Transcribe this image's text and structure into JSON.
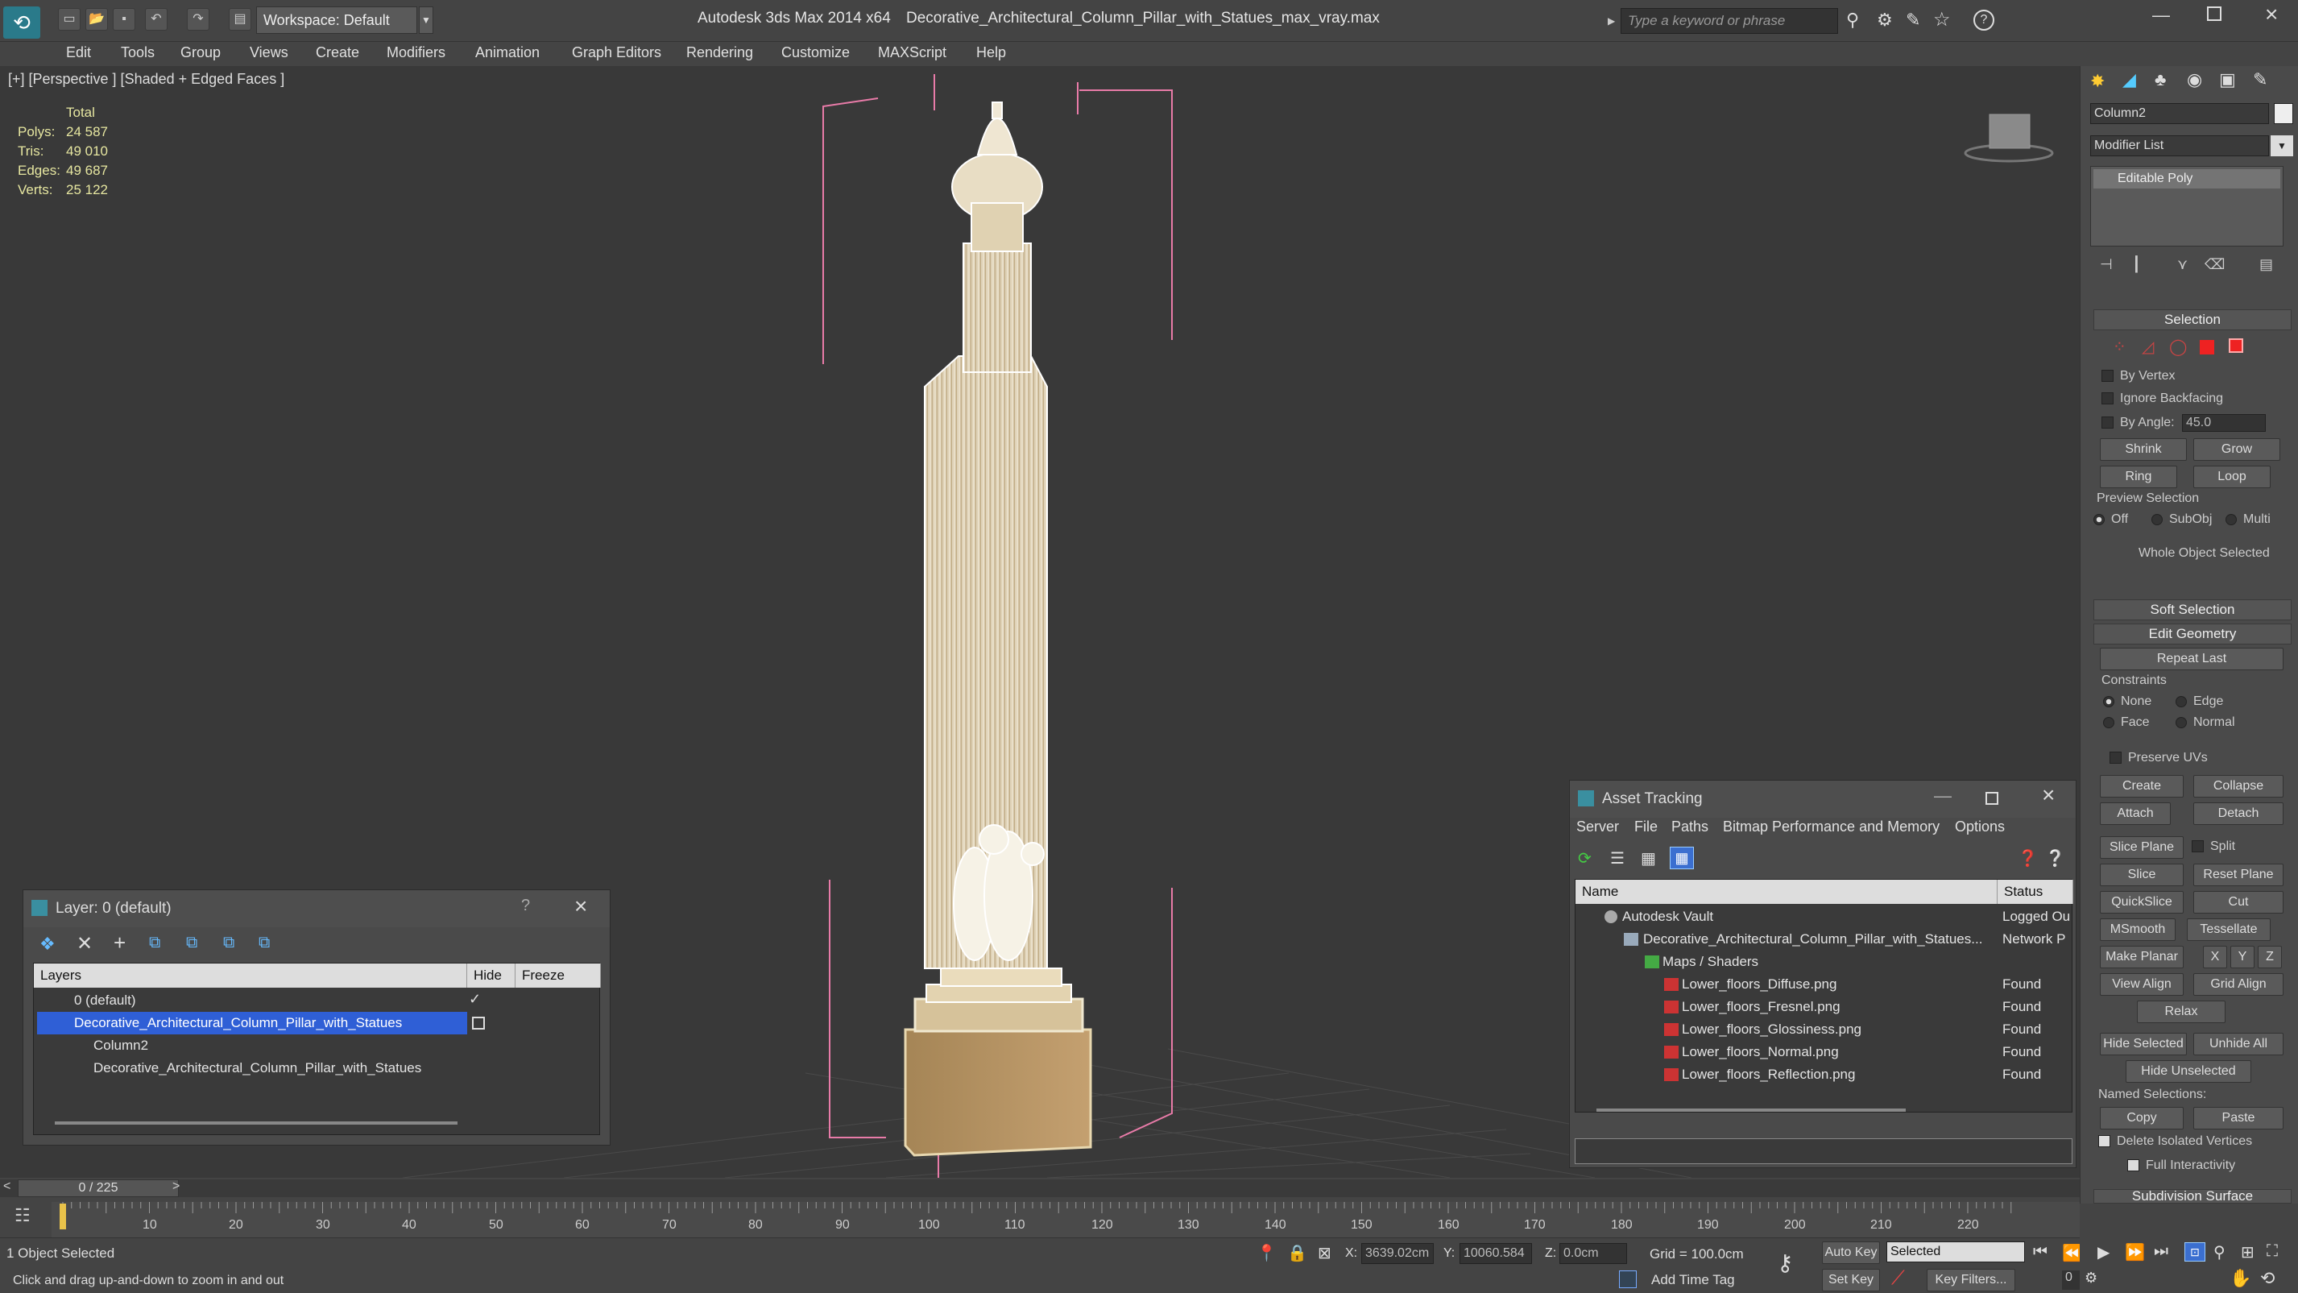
{
  "title": {
    "app": "Autodesk 3ds Max  2014 x64",
    "file": "Decorative_Architectural_Column_Pillar_with_Statues_max_vray.max"
  },
  "workspace": "Workspace: Default",
  "search_placeholder": "Type a keyword or phrase",
  "menu": [
    "Edit",
    "Tools",
    "Group",
    "Views",
    "Create",
    "Modifiers",
    "Animation",
    "Graph Editors",
    "Rendering",
    "Customize",
    "MAXScript",
    "Help"
  ],
  "viewport": {
    "label": "[+] [Perspective ] [Shaded + Edged Faces ]",
    "stats": {
      "header": "Total",
      "rows": [
        [
          "Polys:",
          "24 587"
        ],
        [
          "Tris:",
          "49 010"
        ],
        [
          "Edges:",
          "49 687"
        ],
        [
          "Verts:",
          "25 122"
        ]
      ]
    }
  },
  "cmd": {
    "object_name": "Column2",
    "modifier_list": "Modifier List",
    "stack_item": "Editable Poly",
    "selection": "Selection",
    "by_vertex": "By Vertex",
    "ignore_backfacing": "Ignore Backfacing",
    "by_angle": "By Angle:",
    "angle_value": "45.0",
    "shrink": "Shrink",
    "grow": "Grow",
    "ring": "Ring",
    "loop": "Loop",
    "preview_selection": "Preview Selection",
    "preview_opts": [
      "Off",
      "SubObj",
      "Multi"
    ],
    "whole_object": "Whole Object Selected",
    "soft_selection": "Soft Selection",
    "edit_geometry": "Edit Geometry",
    "repeat_last": "Repeat Last",
    "constraints": "Constraints",
    "c_none": "None",
    "c_edge": "Edge",
    "c_face": "Face",
    "c_normal": "Normal",
    "preserve_uvs": "Preserve UVs",
    "create": "Create",
    "collapse": "Collapse",
    "attach": "Attach",
    "detach": "Detach",
    "slice_plane": "Slice Plane",
    "split": "Split",
    "slice": "Slice",
    "reset_plane": "Reset Plane",
    "quickslice": "QuickSlice",
    "cut": "Cut",
    "msmooth": "MSmooth",
    "tessellate": "Tessellate",
    "make_planar": "Make Planar",
    "x": "X",
    "y": "Y",
    "z": "Z",
    "view_align": "View Align",
    "grid_align": "Grid Align",
    "relax": "Relax",
    "hide_selected": "Hide Selected",
    "unhide_all": "Unhide All",
    "hide_unselected": "Hide Unselected",
    "named_selections": "Named Selections:",
    "copy": "Copy",
    "paste": "Paste",
    "delete_isolated": "Delete Isolated Vertices",
    "full_interactivity": "Full Interactivity",
    "subdivision_surface": "Subdivision Surface"
  },
  "layer_win": {
    "title": "Layer: 0 (default)",
    "help": "?",
    "cols": [
      "Layers",
      "Hide",
      "Freeze"
    ],
    "rows": [
      "0 (default)",
      "Decorative_Architectural_Column_Pillar_with_Statues",
      "Column2",
      "Decorative_Architectural_Column_Pillar_with_Statues"
    ]
  },
  "asset_win": {
    "title": "Asset Tracking",
    "menu": [
      "Server",
      "File",
      "Paths",
      "Bitmap Performance and Memory",
      "Options"
    ],
    "cols": [
      "Name",
      "Status"
    ],
    "rows": [
      {
        "name": "Autodesk Vault",
        "status": "Logged Ou"
      },
      {
        "name": "Decorative_Architectural_Column_Pillar_with_Statues...",
        "status": "Network P"
      },
      {
        "name": "Maps / Shaders",
        "status": ""
      },
      {
        "name": "Lower_floors_Diffuse.png",
        "status": "Found"
      },
      {
        "name": "Lower_floors_Fresnel.png",
        "status": "Found"
      },
      {
        "name": "Lower_floors_Glossiness.png",
        "status": "Found"
      },
      {
        "name": "Lower_floors_Normal.png",
        "status": "Found"
      },
      {
        "name": "Lower_floors_Reflection.png",
        "status": "Found"
      }
    ]
  },
  "timeline": {
    "frame": "0 / 225",
    "ticks": [
      "10",
      "20",
      "30",
      "40",
      "50",
      "60",
      "70",
      "80",
      "90",
      "100",
      "110",
      "120",
      "130",
      "140",
      "150",
      "160",
      "170",
      "180",
      "190",
      "200",
      "210",
      "220"
    ]
  },
  "status": {
    "objects": "1 Object Selected",
    "hint": "Click and drag up-and-down to zoom in and out",
    "x_label": "X:",
    "x_val": "3639.02cm",
    "y_label": "Y:",
    "y_val": "10060.584",
    "z_label": "Z:",
    "z_val": "0.0cm",
    "grid": "Grid = 100.0cm",
    "auto_key": "Auto Key",
    "selected": "Selected",
    "set_key": "Set Key",
    "key_filters": "Key Filters...",
    "add_time_tag": "Add Time Tag",
    "frame": "0"
  }
}
